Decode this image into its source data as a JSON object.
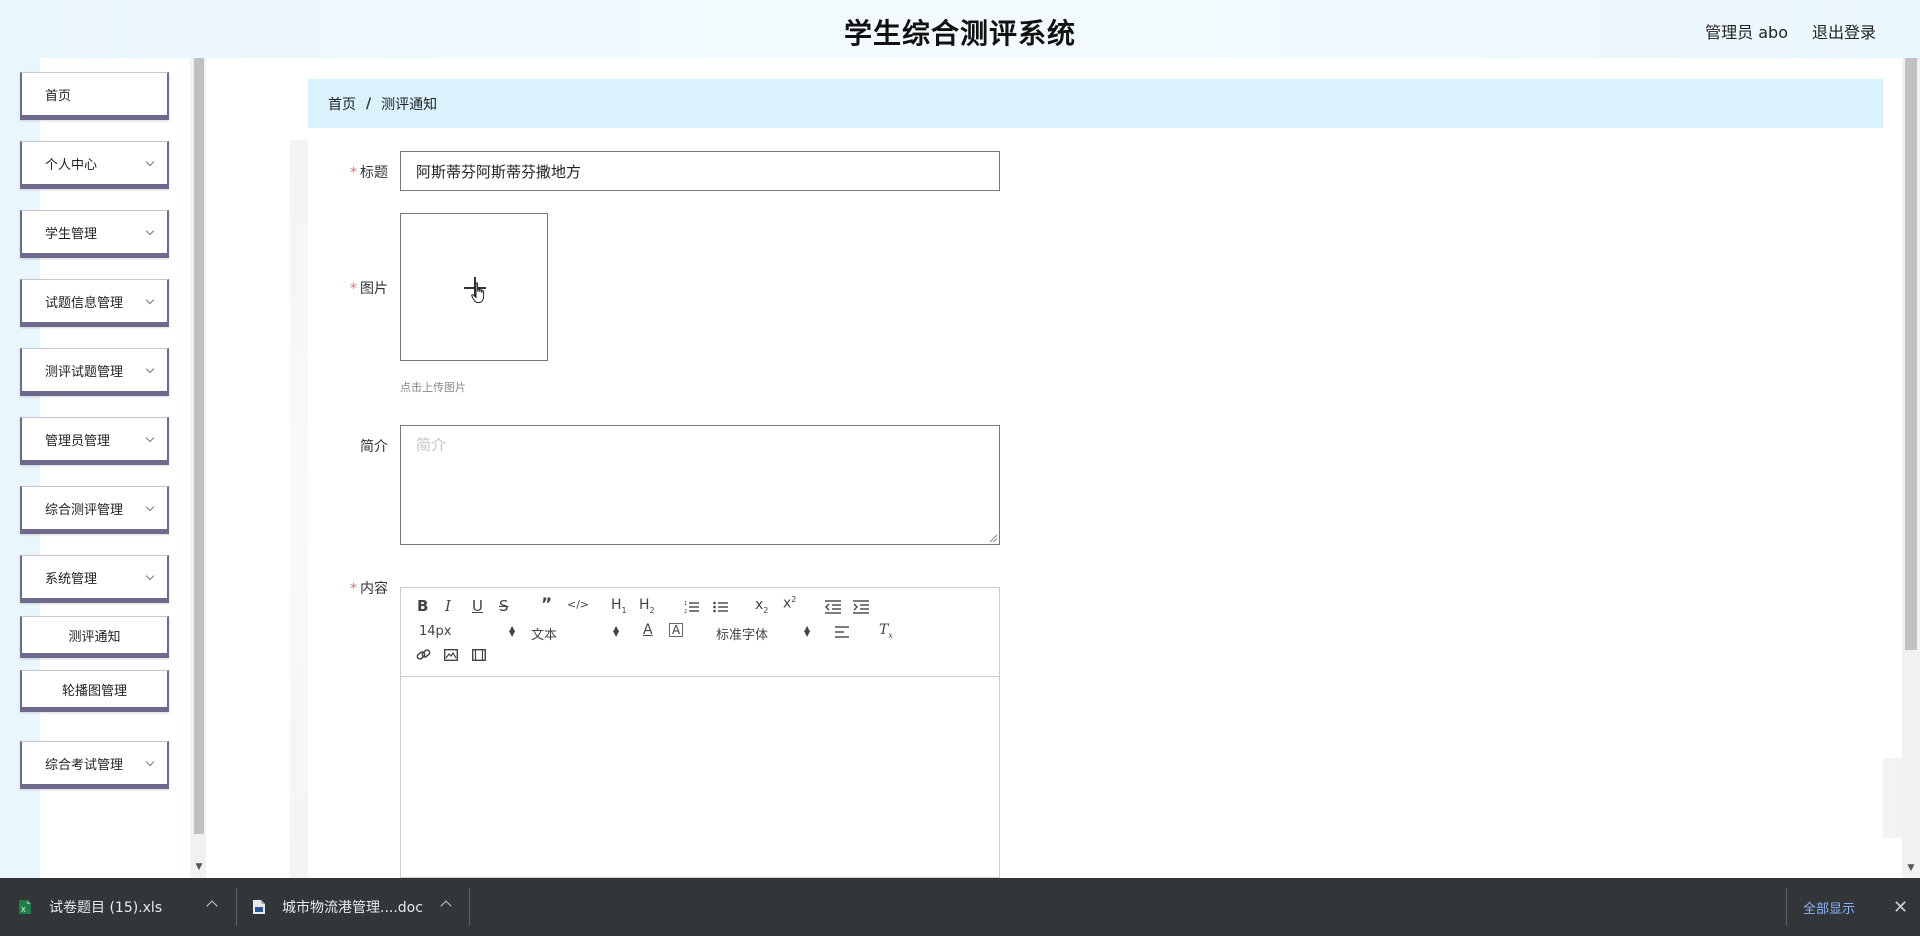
{
  "header": {
    "title": "学生综合测评系统",
    "user_label": "管理员 abo",
    "logout_label": "退出登录"
  },
  "sidebar": {
    "items": [
      {
        "label": "首页",
        "has_arrow": false
      },
      {
        "label": "个人中心",
        "has_arrow": true
      },
      {
        "label": "学生管理",
        "has_arrow": true
      },
      {
        "label": "试题信息管理",
        "has_arrow": true
      },
      {
        "label": "测评试题管理",
        "has_arrow": true
      },
      {
        "label": "管理员管理",
        "has_arrow": true
      },
      {
        "label": "综合测评管理",
        "has_arrow": true
      },
      {
        "label": "系统管理",
        "has_arrow": true
      },
      {
        "label": "测评通知",
        "has_arrow": false
      },
      {
        "label": "轮播图管理",
        "has_arrow": false
      },
      {
        "label": "综合考试管理",
        "has_arrow": true
      }
    ]
  },
  "breadcrumb": {
    "home": "首页",
    "separator": "/",
    "current": "测评通知"
  },
  "form": {
    "required_mark": "*",
    "title_label": "标题",
    "title_value": "阿斯蒂芬阿斯蒂芬撒地方",
    "image_label": "图片",
    "upload_tip": "点击上传图片",
    "intro_label": "简介",
    "intro_placeholder": "简介",
    "content_label": "内容"
  },
  "editor": {
    "font_size": "14px",
    "header_select": "文本",
    "font_family": "标准字体"
  },
  "downloads": {
    "items": [
      {
        "name": "试卷题目 (15).xls",
        "icon": "excel-file-icon"
      },
      {
        "name": "城市物流港管理....doc",
        "icon": "word-file-icon"
      }
    ],
    "show_all": "全部显示"
  },
  "colors": {
    "header_bg": "#eaf7fd",
    "breadcrumb_bg": "#d9f2fc",
    "menu_border": "#6f6a8d",
    "required": "#f56c6c",
    "download_bar": "#323639"
  }
}
